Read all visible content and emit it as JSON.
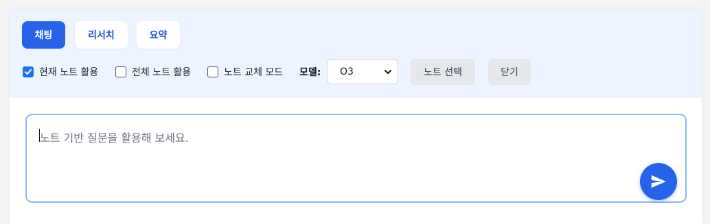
{
  "tabs": [
    {
      "label": "채팅",
      "active": true
    },
    {
      "label": "리서치",
      "active": false
    },
    {
      "label": "요약",
      "active": false
    }
  ],
  "options": {
    "current_note": {
      "label": "현재 노트 활용",
      "checked": true
    },
    "all_notes": {
      "label": "전체 노트 활용",
      "checked": false
    },
    "note_swap": {
      "label": "노트 교체 모드",
      "checked": false
    }
  },
  "model": {
    "label": "모델:",
    "value": "O3"
  },
  "buttons": {
    "select_note": "노트 선택",
    "close": "닫기"
  },
  "input": {
    "placeholder": "노트 기반 질문을 활용해 보세요.",
    "value": ""
  },
  "colors": {
    "accent": "#2563eb",
    "toolbar_bg": "#eef4ff",
    "input_border": "#8ab8f5"
  },
  "icons": {
    "send": "send-icon",
    "check": "check-icon",
    "dropdown": "chevron-down-icon"
  }
}
